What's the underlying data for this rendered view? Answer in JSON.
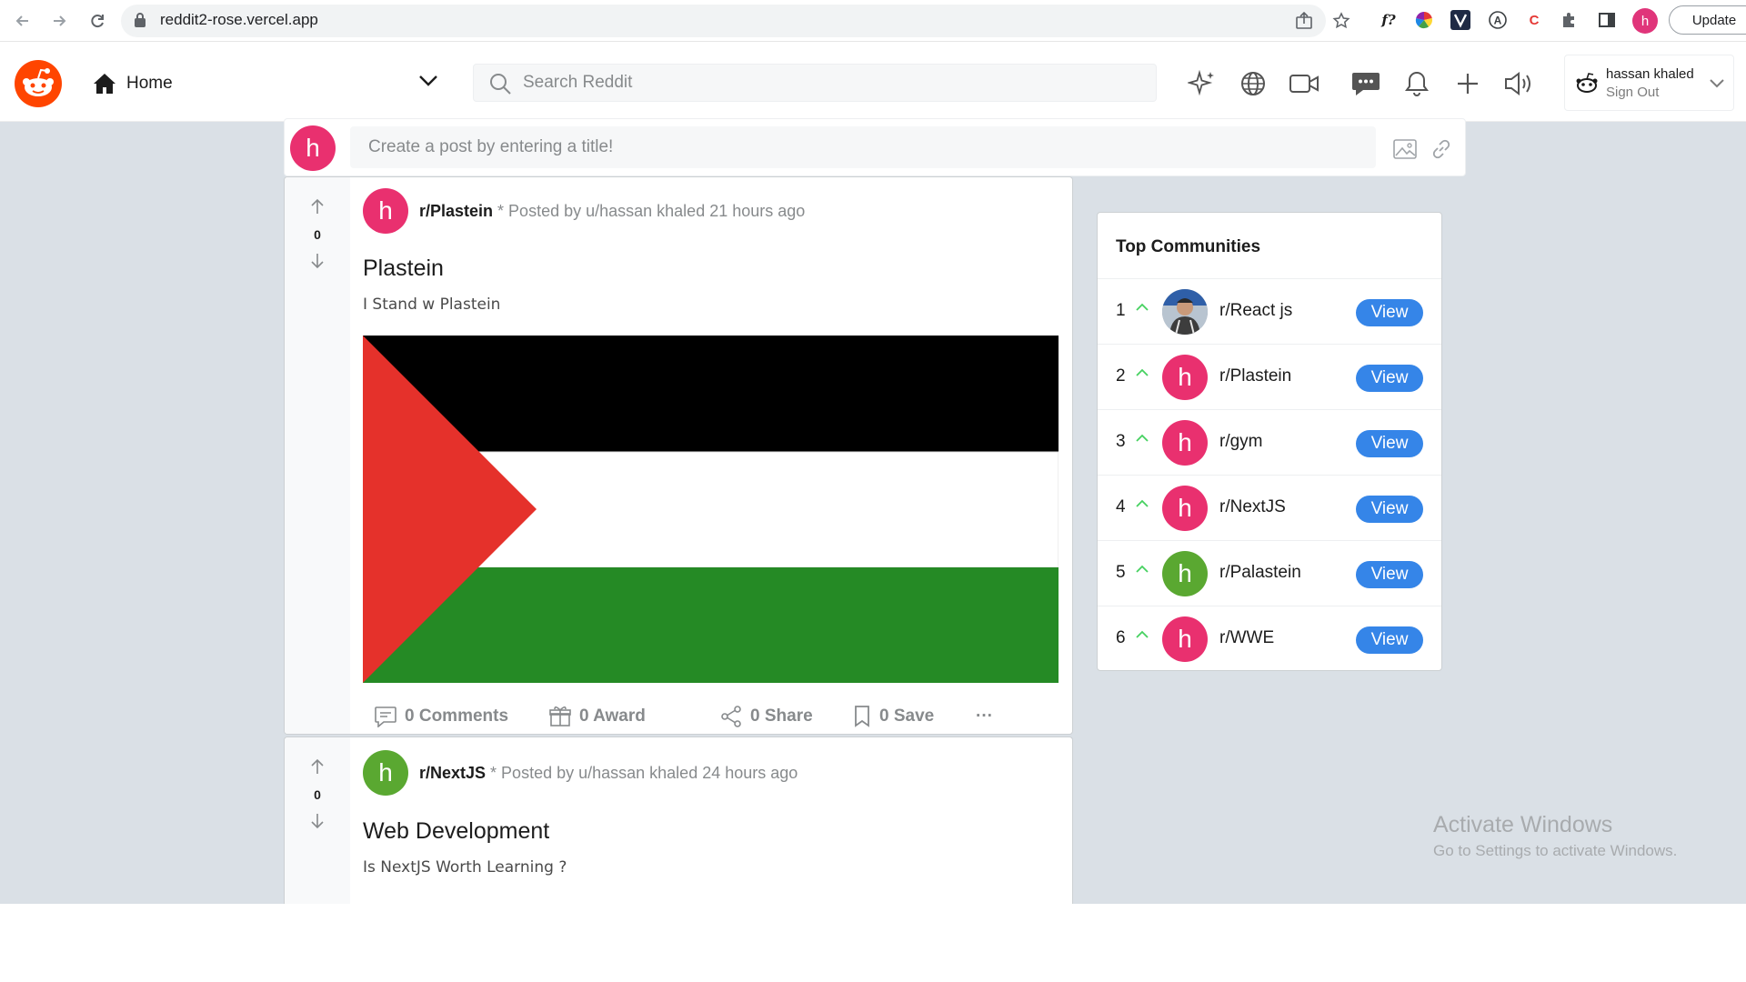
{
  "browser": {
    "url": "reddit2-rose.vercel.app",
    "profile_initial": "h",
    "update_label": "Update",
    "extensions": [
      "f?",
      "A",
      "C"
    ]
  },
  "header": {
    "home_label": "Home",
    "search_placeholder": "Search Reddit",
    "user_name": "hassan khaled",
    "sign_out": "Sign Out"
  },
  "create_post": {
    "avatar_initial": "h",
    "placeholder": "Create a post by entering a title!"
  },
  "posts": [
    {
      "votes": "0",
      "avatar_initial": "h",
      "avatar_color": "#e9306f",
      "subreddit": "r/Plastein",
      "meta": " * Posted by u/hassan khaled 21 hours ago",
      "title": "Plastein",
      "body": "I Stand w Plastein",
      "comments": "0 Comments",
      "award": "0 Award",
      "share": "0 Share",
      "save": "0 Save",
      "more": "···"
    },
    {
      "votes": "0",
      "avatar_initial": "h",
      "avatar_color": "#5aa831",
      "subreddit": "r/NextJS",
      "meta": " * Posted by u/hassan khaled 24 hours ago",
      "title": "Web Development",
      "body": "Is NextJS Worth Learning ?"
    }
  ],
  "sidebar": {
    "title": "Top Communities",
    "view_label": "View",
    "communities": [
      {
        "rank": "1",
        "name": "r/React js",
        "initial": "",
        "color": "#8a96a3"
      },
      {
        "rank": "2",
        "name": "r/Plastein",
        "initial": "h",
        "color": "#e9306f"
      },
      {
        "rank": "3",
        "name": "r/gym",
        "initial": "h",
        "color": "#e9306f"
      },
      {
        "rank": "4",
        "name": "r/NextJS",
        "initial": "h",
        "color": "#e9306f"
      },
      {
        "rank": "5",
        "name": "r/Palastein",
        "initial": "h",
        "color": "#5aa831"
      },
      {
        "rank": "6",
        "name": "r/WWE",
        "initial": "h",
        "color": "#e9306f"
      }
    ]
  },
  "watermark": {
    "title": "Activate Windows",
    "subtitle": "Go to Settings to activate Windows."
  },
  "colors": {
    "accent": "#3585e8",
    "brand": "#ff4500",
    "flag_black": "#000000",
    "flag_white": "#ffffff",
    "flag_green": "#258a25",
    "flag_red": "#e5312b"
  }
}
